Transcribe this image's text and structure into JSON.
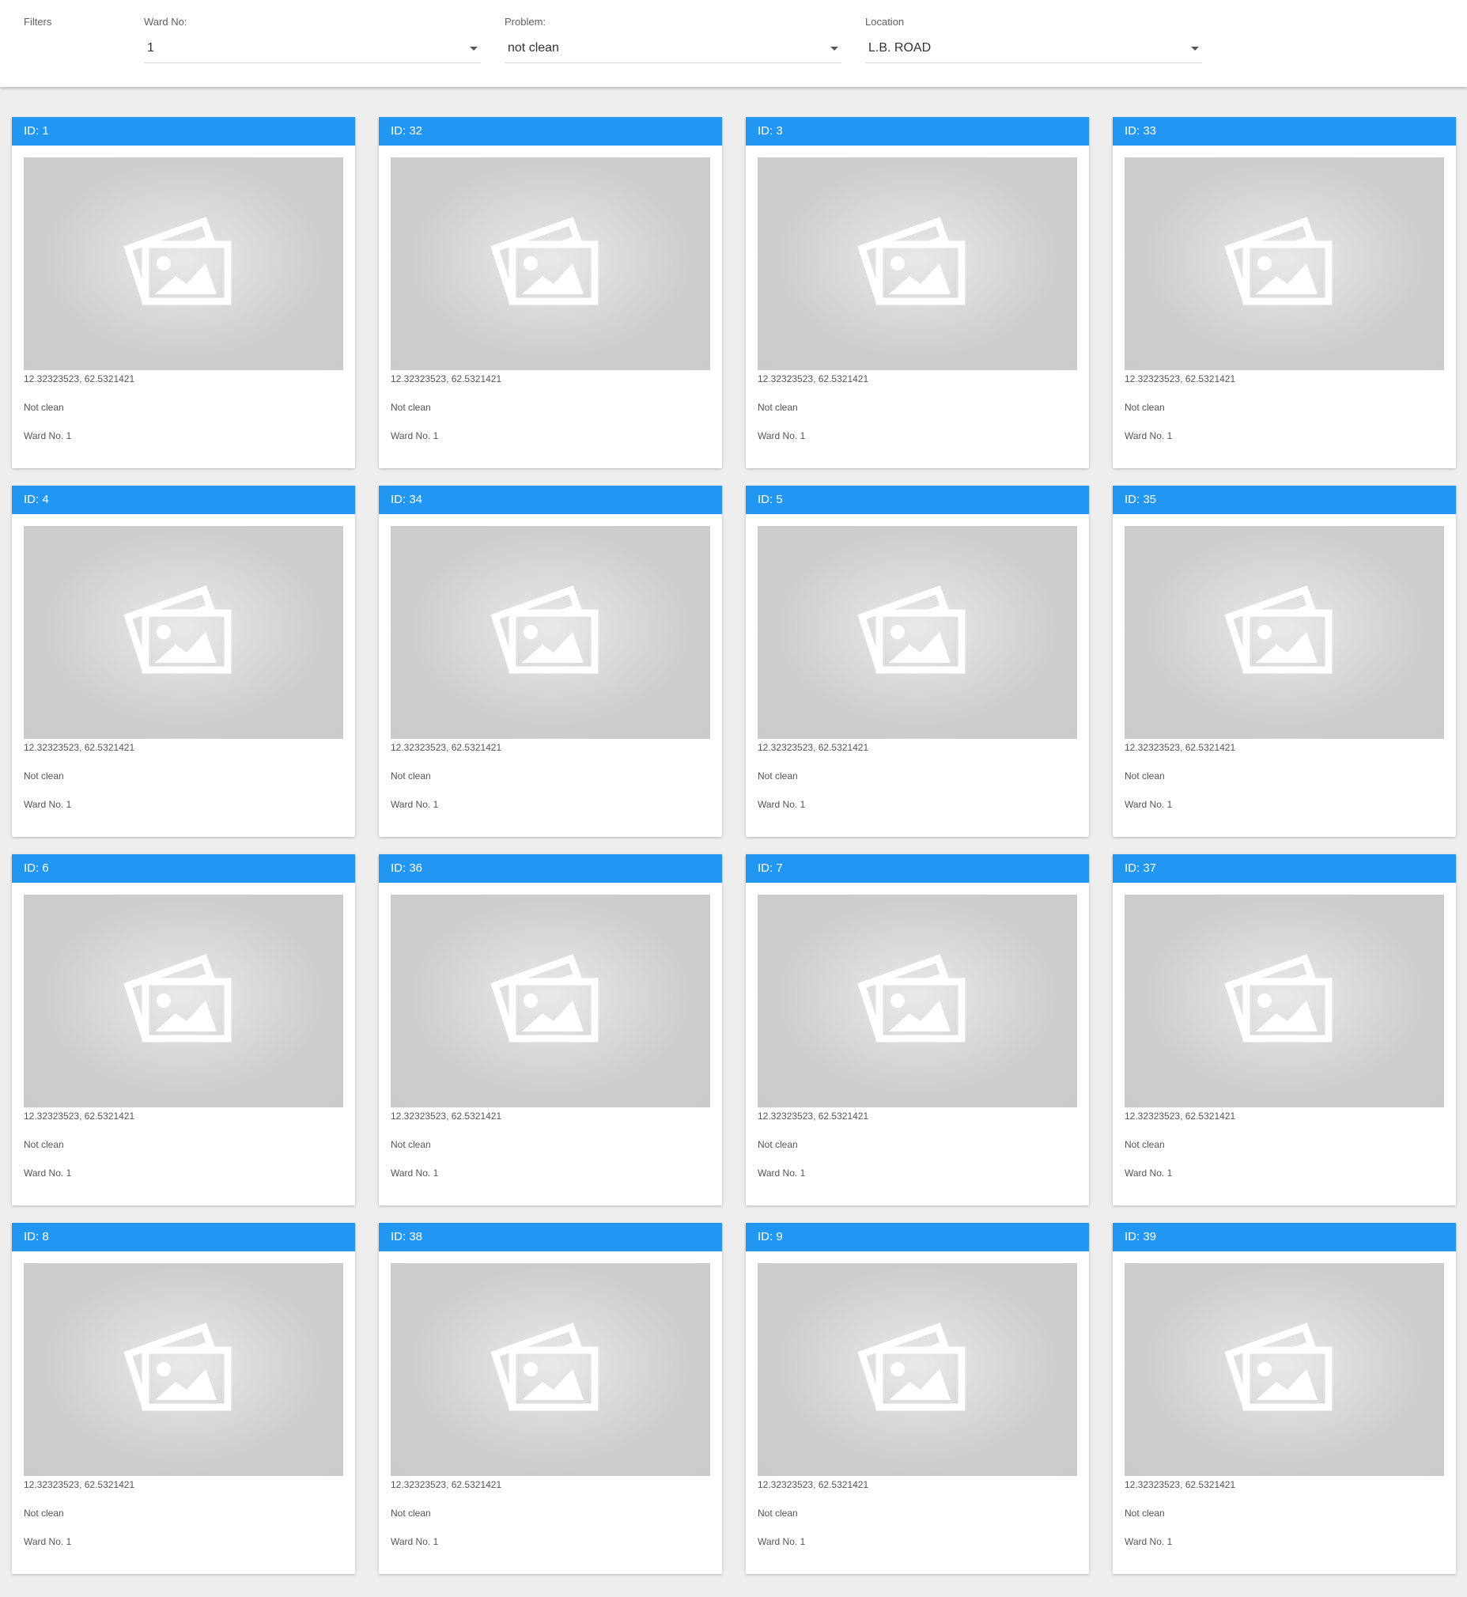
{
  "filters": {
    "title": "Filters",
    "ward": {
      "label": "Ward No:",
      "value": "1"
    },
    "problem": {
      "label": "Problem:",
      "value": "not clean"
    },
    "location": {
      "label": "Location",
      "value": "L.B. ROAD"
    }
  },
  "theme": {
    "header_color": "#2196f3"
  },
  "cards": [
    {
      "id_label": "ID: 1",
      "coords": "12.32323523, 62.5321421",
      "problem": "Not clean",
      "ward": "Ward No. 1",
      "icon": "image-placeholder-icon"
    },
    {
      "id_label": "ID: 32",
      "coords": "12.32323523, 62.5321421",
      "problem": "Not clean",
      "ward": "Ward No. 1",
      "icon": "image-placeholder-icon"
    },
    {
      "id_label": "ID: 3",
      "coords": "12.32323523, 62.5321421",
      "problem": "Not clean",
      "ward": "Ward No. 1",
      "icon": "image-placeholder-icon"
    },
    {
      "id_label": "ID: 33",
      "coords": "12.32323523, 62.5321421",
      "problem": "Not clean",
      "ward": "Ward No. 1",
      "icon": "image-placeholder-icon"
    },
    {
      "id_label": "ID: 4",
      "coords": "12.32323523, 62.5321421",
      "problem": "Not clean",
      "ward": "Ward No. 1",
      "icon": "image-placeholder-icon"
    },
    {
      "id_label": "ID: 34",
      "coords": "12.32323523, 62.5321421",
      "problem": "Not clean",
      "ward": "Ward No. 1",
      "icon": "image-placeholder-icon"
    },
    {
      "id_label": "ID: 5",
      "coords": "12.32323523, 62.5321421",
      "problem": "Not clean",
      "ward": "Ward No. 1",
      "icon": "image-placeholder-icon"
    },
    {
      "id_label": "ID: 35",
      "coords": "12.32323523, 62.5321421",
      "problem": "Not clean",
      "ward": "Ward No. 1",
      "icon": "image-placeholder-icon"
    },
    {
      "id_label": "ID: 6",
      "coords": "12.32323523, 62.5321421",
      "problem": "Not clean",
      "ward": "Ward No. 1",
      "icon": "image-placeholder-icon"
    },
    {
      "id_label": "ID: 36",
      "coords": "12.32323523, 62.5321421",
      "problem": "Not clean",
      "ward": "Ward No. 1",
      "icon": "image-placeholder-icon"
    },
    {
      "id_label": "ID: 7",
      "coords": "12.32323523, 62.5321421",
      "problem": "Not clean",
      "ward": "Ward No. 1",
      "icon": "image-placeholder-icon"
    },
    {
      "id_label": "ID: 37",
      "coords": "12.32323523, 62.5321421",
      "problem": "Not clean",
      "ward": "Ward No. 1",
      "icon": "image-placeholder-icon"
    },
    {
      "id_label": "ID: 8",
      "coords": "12.32323523, 62.5321421",
      "problem": "Not clean",
      "ward": "Ward No. 1",
      "icon": "image-placeholder-icon"
    },
    {
      "id_label": "ID: 38",
      "coords": "12.32323523, 62.5321421",
      "problem": "Not clean",
      "ward": "Ward No. 1",
      "icon": "image-placeholder-icon"
    },
    {
      "id_label": "ID: 9",
      "coords": "12.32323523, 62.5321421",
      "problem": "Not clean",
      "ward": "Ward No. 1",
      "icon": "image-placeholder-icon"
    },
    {
      "id_label": "ID: 39",
      "coords": "12.32323523, 62.5321421",
      "problem": "Not clean",
      "ward": "Ward No. 1",
      "icon": "image-placeholder-icon"
    }
  ]
}
